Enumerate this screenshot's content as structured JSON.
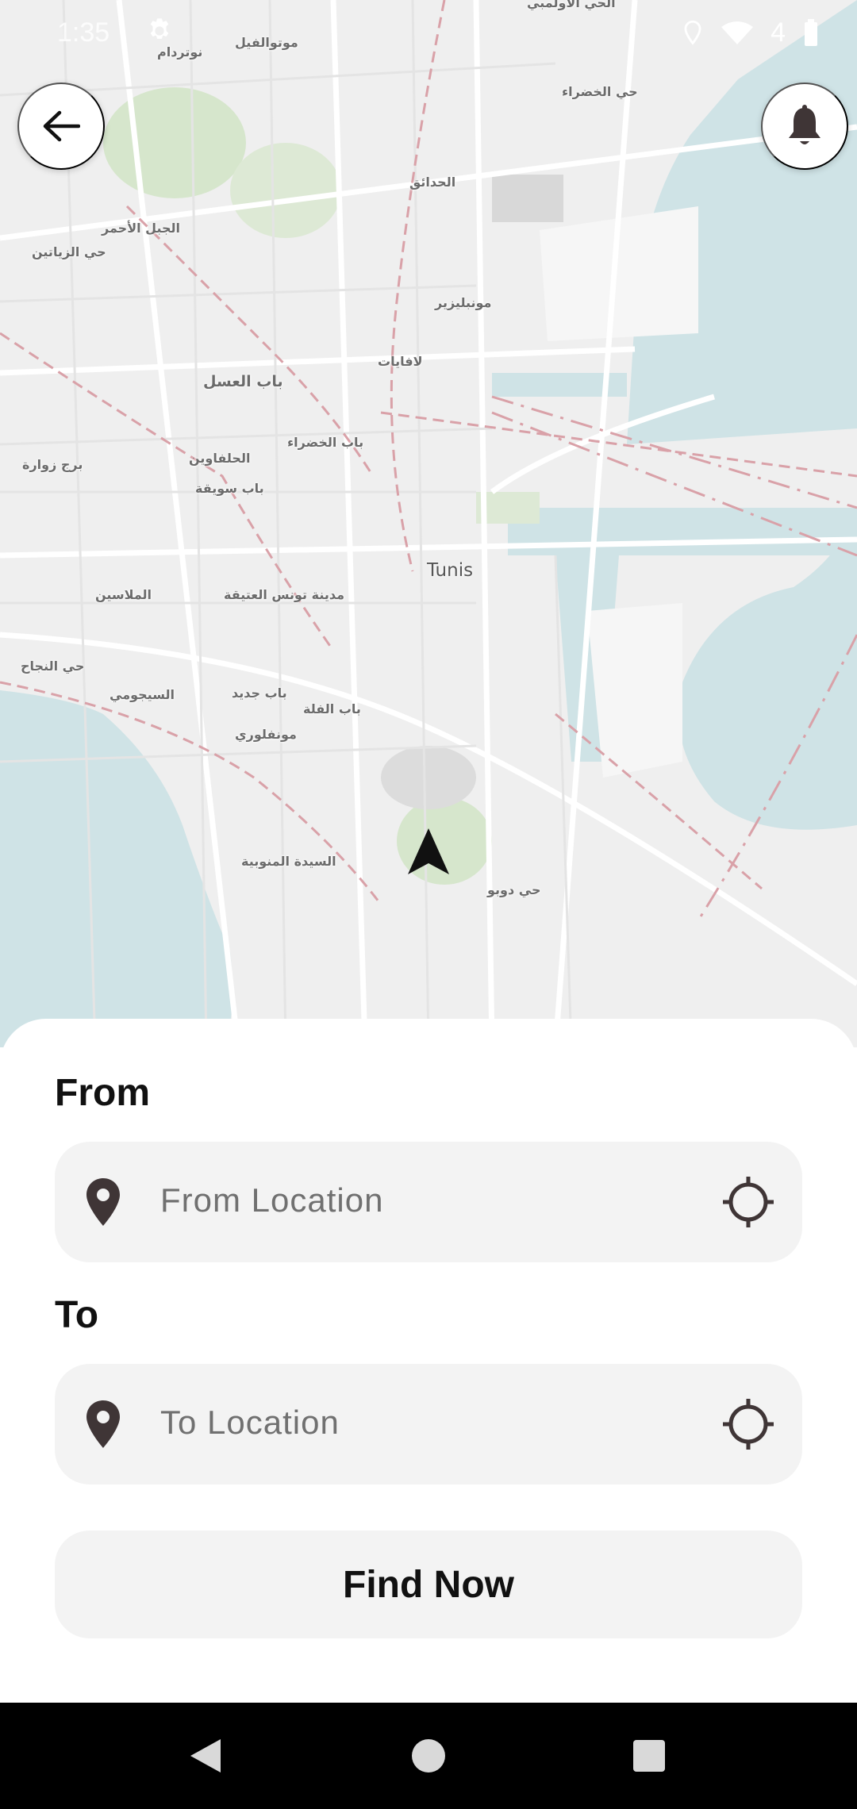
{
  "status_bar": {
    "time": "1:35",
    "battery": "4"
  },
  "map": {
    "city_label": "Tunis",
    "place_labels": [
      "نوتردام",
      "موتوالفيل",
      "الحي الأولمبي",
      "حي الخضراء",
      "الحدائق",
      "الجبل الأحمر",
      "حي الزياتين",
      "مونبليزير",
      "لافايات",
      "باب العسل",
      "باب الخضراء",
      "الحلفاوين",
      "برج زوارة",
      "باب سويقة",
      "الملاسين",
      "مدينة تونس العتيقة",
      "حي النجاح",
      "السيجومي",
      "باب جديد",
      "باب الفلة",
      "مونفلوري",
      "السيدة المنوبية",
      "حي دوبو"
    ],
    "colors": {
      "water": "#cfe3e6",
      "park": "#d6e6cc",
      "land": "#efefef",
      "road": "#ffffff",
      "boundary": "#d9a1a8"
    }
  },
  "controls": {
    "back_icon": "arrow-left-icon",
    "notifications_icon": "bell-icon",
    "location_marker_icon": "navigation-arrow-icon"
  },
  "form": {
    "from_label": "From",
    "from_placeholder": "From Location",
    "to_label": "To",
    "to_placeholder": "To Location",
    "find_button": "Find Now"
  },
  "navbar": {
    "icons": [
      "back-triangle-icon",
      "home-circle-icon",
      "recents-square-icon"
    ]
  }
}
